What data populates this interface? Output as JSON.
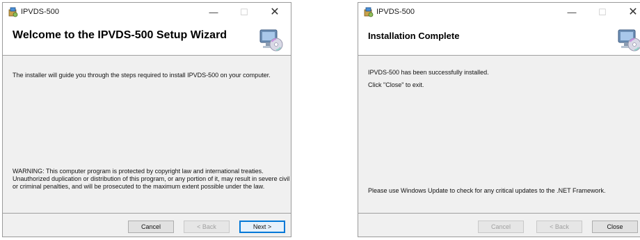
{
  "left": {
    "app_title": "IPVDS-500",
    "heading": "Welcome to the IPVDS-500 Setup Wizard",
    "intro": "The installer will guide you through the steps required to install IPVDS-500 on your computer.",
    "warning_lines": [
      "WARNING: This computer program is protected by copyright law and international treaties.",
      "Unauthorized duplication or distribution of this program, or any portion of it, may result in severe civil",
      "or criminal penalties, and will be prosecuted to the maximum extent possible under the law."
    ],
    "buttons": {
      "cancel": "Cancel",
      "back": "< Back",
      "next": "Next >"
    }
  },
  "right": {
    "app_title": "IPVDS-500",
    "heading": "Installation Complete",
    "line1": "IPVDS-500 has been successfully installed.",
    "line2": "Click \"Close\" to exit.",
    "update_note": "Please use Windows Update to check for any critical updates to the .NET Framework.",
    "buttons": {
      "cancel": "Cancel",
      "back": "< Back",
      "close": "Close"
    }
  },
  "icons": {
    "app_icon": "installer-package-icon",
    "banner_icon": "computer-cd-icon",
    "minimize": "minimize-icon",
    "maximize": "maximize-icon",
    "close": "close-icon"
  },
  "colors": {
    "accent": "#0078d7",
    "disabled_text": "#a0a0a0"
  }
}
